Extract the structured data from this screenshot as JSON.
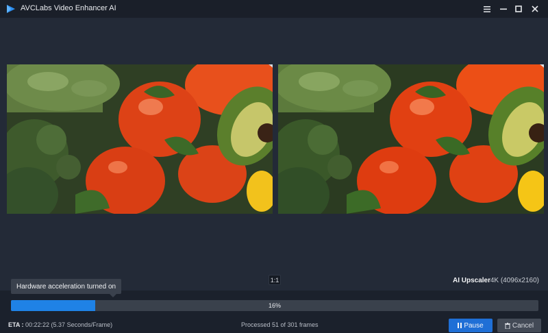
{
  "window": {
    "title": "AVCLabs Video Enhancer AI",
    "accent_color": "#1f82e6"
  },
  "preview": {
    "ratio_label": "1:1",
    "mode_label": "AI Upscaler",
    "resolution_label": "4K (4096x2160)"
  },
  "progress": {
    "tooltip": "Hardware acceleration turned on",
    "percent": 16,
    "percent_label": "16%",
    "eta_label": "ETA :",
    "eta_value": "00:22:22 (5.37 Seconds/Frame)",
    "processed_text": "Processed 51 of 301 frames"
  },
  "buttons": {
    "pause_label": "Pause",
    "cancel_label": "Cancel",
    "pause_icon": "pause-icon",
    "cancel_icon": "trash-icon"
  }
}
